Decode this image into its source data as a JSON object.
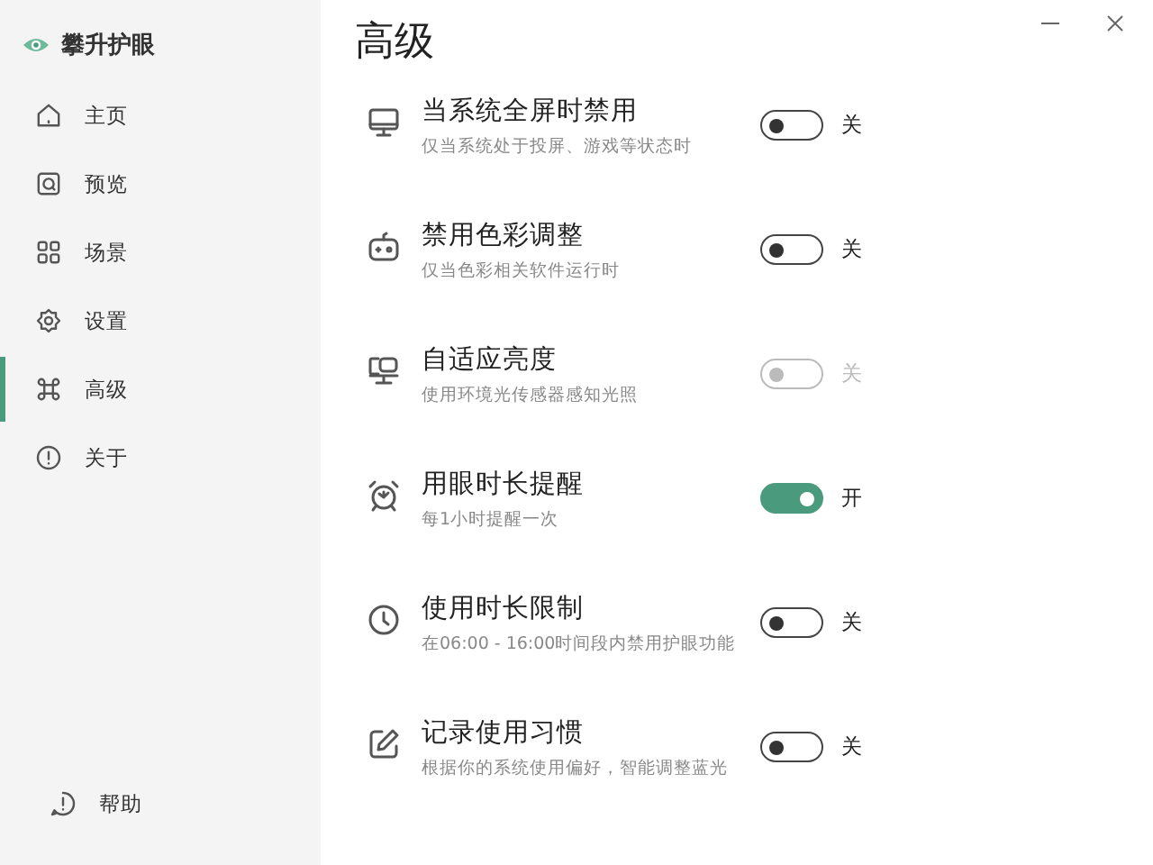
{
  "app": {
    "name": "攀升护眼"
  },
  "nav": [
    {
      "label": "主页",
      "selected": false
    },
    {
      "label": "预览",
      "selected": false
    },
    {
      "label": "场景",
      "selected": false
    },
    {
      "label": "设置",
      "selected": false
    },
    {
      "label": "高级",
      "selected": true
    },
    {
      "label": "关于",
      "selected": false
    }
  ],
  "help": {
    "label": "帮助"
  },
  "page": {
    "title": "高级"
  },
  "settings": [
    {
      "title": "当系统全屏时禁用",
      "subtitle": "仅当系统处于投屏、游戏等状态时",
      "on": false,
      "disabled": false,
      "state_label": "关"
    },
    {
      "title": "禁用色彩调整",
      "subtitle": "仅当色彩相关软件运行时",
      "on": false,
      "disabled": false,
      "state_label": "关"
    },
    {
      "title": "自适应亮度",
      "subtitle": "使用环境光传感器感知光照",
      "on": false,
      "disabled": true,
      "state_label": "关"
    },
    {
      "title": "用眼时长提醒",
      "subtitle": "每1小时提醒一次",
      "on": true,
      "disabled": false,
      "state_label": "开"
    },
    {
      "title": "使用时长限制",
      "subtitle": "在06:00 - 16:00时间段内禁用护眼功能",
      "on": false,
      "disabled": false,
      "state_label": "关"
    },
    {
      "title": "记录使用习惯",
      "subtitle": "根据你的系统使用偏好，智能调整蓝光",
      "on": false,
      "disabled": false,
      "state_label": "关"
    }
  ]
}
